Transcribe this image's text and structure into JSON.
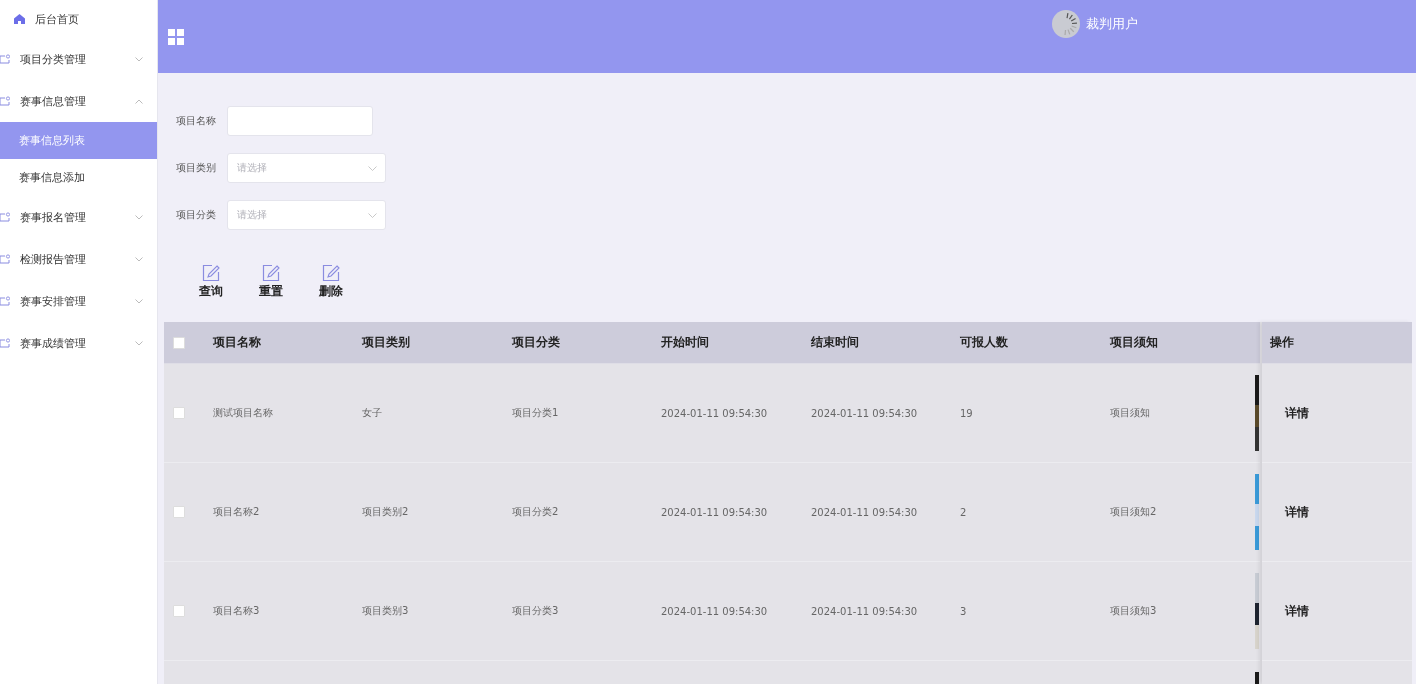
{
  "sidebar": {
    "items": [
      {
        "kind": "link",
        "label": "后台首页"
      },
      {
        "kind": "group",
        "label": "项目分类管理",
        "expanded": false
      },
      {
        "kind": "group",
        "label": "赛事信息管理",
        "expanded": true,
        "children": [
          {
            "label": "赛事信息列表",
            "selected": true
          },
          {
            "label": "赛事信息添加",
            "selected": false
          }
        ]
      },
      {
        "kind": "group",
        "label": "赛事报名管理",
        "expanded": false
      },
      {
        "kind": "group",
        "label": "检测报告管理",
        "expanded": false
      },
      {
        "kind": "group",
        "label": "赛事安排管理",
        "expanded": false
      },
      {
        "kind": "group",
        "label": "赛事成绩管理",
        "expanded": false
      }
    ]
  },
  "header": {
    "user": "裁判用户"
  },
  "filters": [
    {
      "kind": "text",
      "label": "项目名称"
    },
    {
      "kind": "select",
      "label": "项目类别",
      "placeholder": "请选择"
    },
    {
      "kind": "select",
      "label": "项目分类",
      "placeholder": "请选择"
    }
  ],
  "actions": [
    "查询",
    "重置",
    "删除"
  ],
  "table": {
    "all_checked": false,
    "columns": [
      "项目名称",
      "项目类别",
      "项目分类",
      "开始时间",
      "结束时间",
      "可报人数",
      "项目须知"
    ],
    "action_column": "操作",
    "rows": [
      {
        "checked": false,
        "cells": [
          "测试项目名称",
          "女子",
          "项目分类1",
          "2024-01-11 09:54:30",
          "2024-01-11 09:54:30",
          "19",
          "项目须知"
        ],
        "action": "详情"
      },
      {
        "checked": false,
        "cells": [
          "项目名称2",
          "项目类别2",
          "项目分类2",
          "2024-01-11 09:54:30",
          "2024-01-11 09:54:30",
          "2",
          "项目须知2"
        ],
        "action": "详情"
      },
      {
        "checked": false,
        "cells": [
          "项目名称3",
          "项目类别3",
          "项目分类3",
          "2024-01-11 09:54:30",
          "2024-01-11 09:54:30",
          "3",
          "项目须知3"
        ],
        "action": "详情"
      }
    ]
  }
}
